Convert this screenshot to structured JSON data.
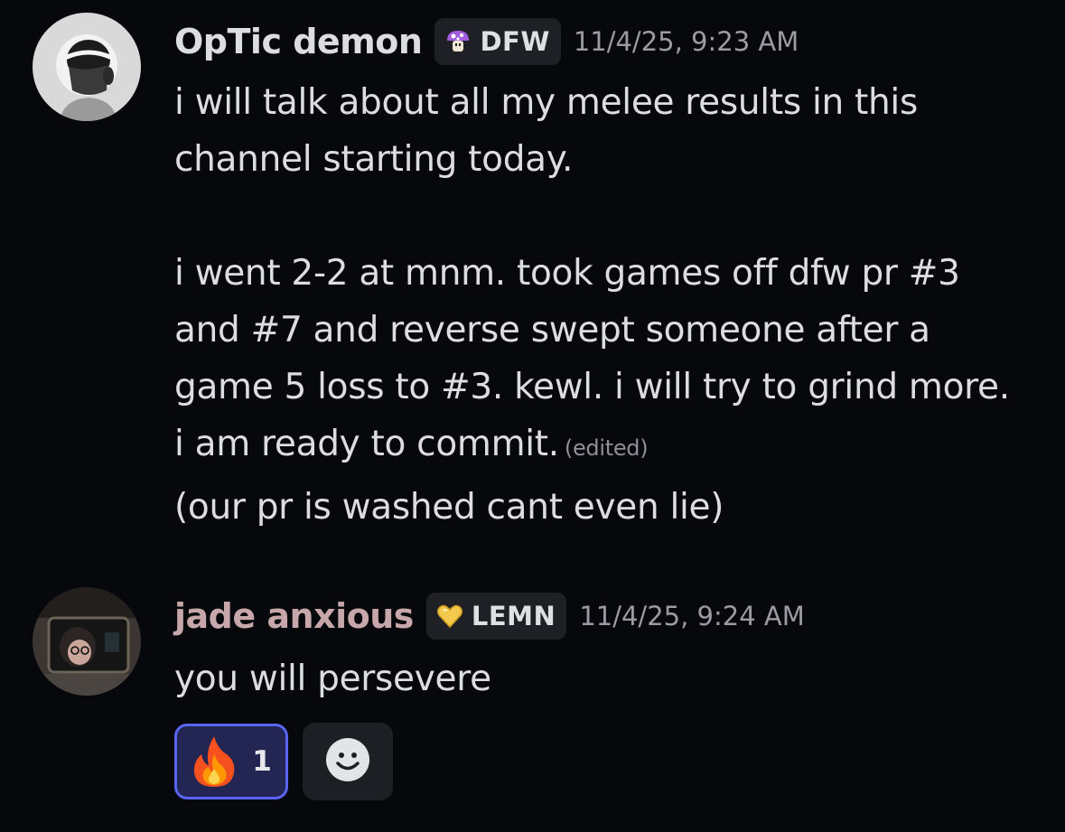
{
  "messages": [
    {
      "username": "OpTic demon",
      "username_color": "#dcdde1",
      "tag": {
        "icon": "purple-mushroom-icon",
        "label": "DFW"
      },
      "timestamp": "11/4/25, 9:23 AM",
      "lines": [
        "i will talk about all my melee results in this",
        "channel starting today.",
        "",
        "i went 2-2 at mnm. took games off dfw pr #3",
        "and #7 and reverse swept someone after a",
        "game 5 loss to #3. kewl. i will try to grind more.",
        "i am ready to commit."
      ],
      "edited_label": "(edited)",
      "followup": "(our pr is washed cant even lie)"
    },
    {
      "username": "jade anxious",
      "username_color": "#c7a7a9",
      "tag": {
        "icon": "gold-heart-icon",
        "label": "LEMN"
      },
      "timestamp": "11/4/25, 9:24 AM",
      "text": "you will persevere",
      "reactions": [
        {
          "emoji": "fire-emoji-icon",
          "count": "1",
          "active": true
        }
      ],
      "add_reaction_icon": "smiley-add-reaction-icon"
    }
  ],
  "colors": {
    "background": "#07080c",
    "accent": "#5865f2",
    "timestamp": "#9a9ba3"
  }
}
